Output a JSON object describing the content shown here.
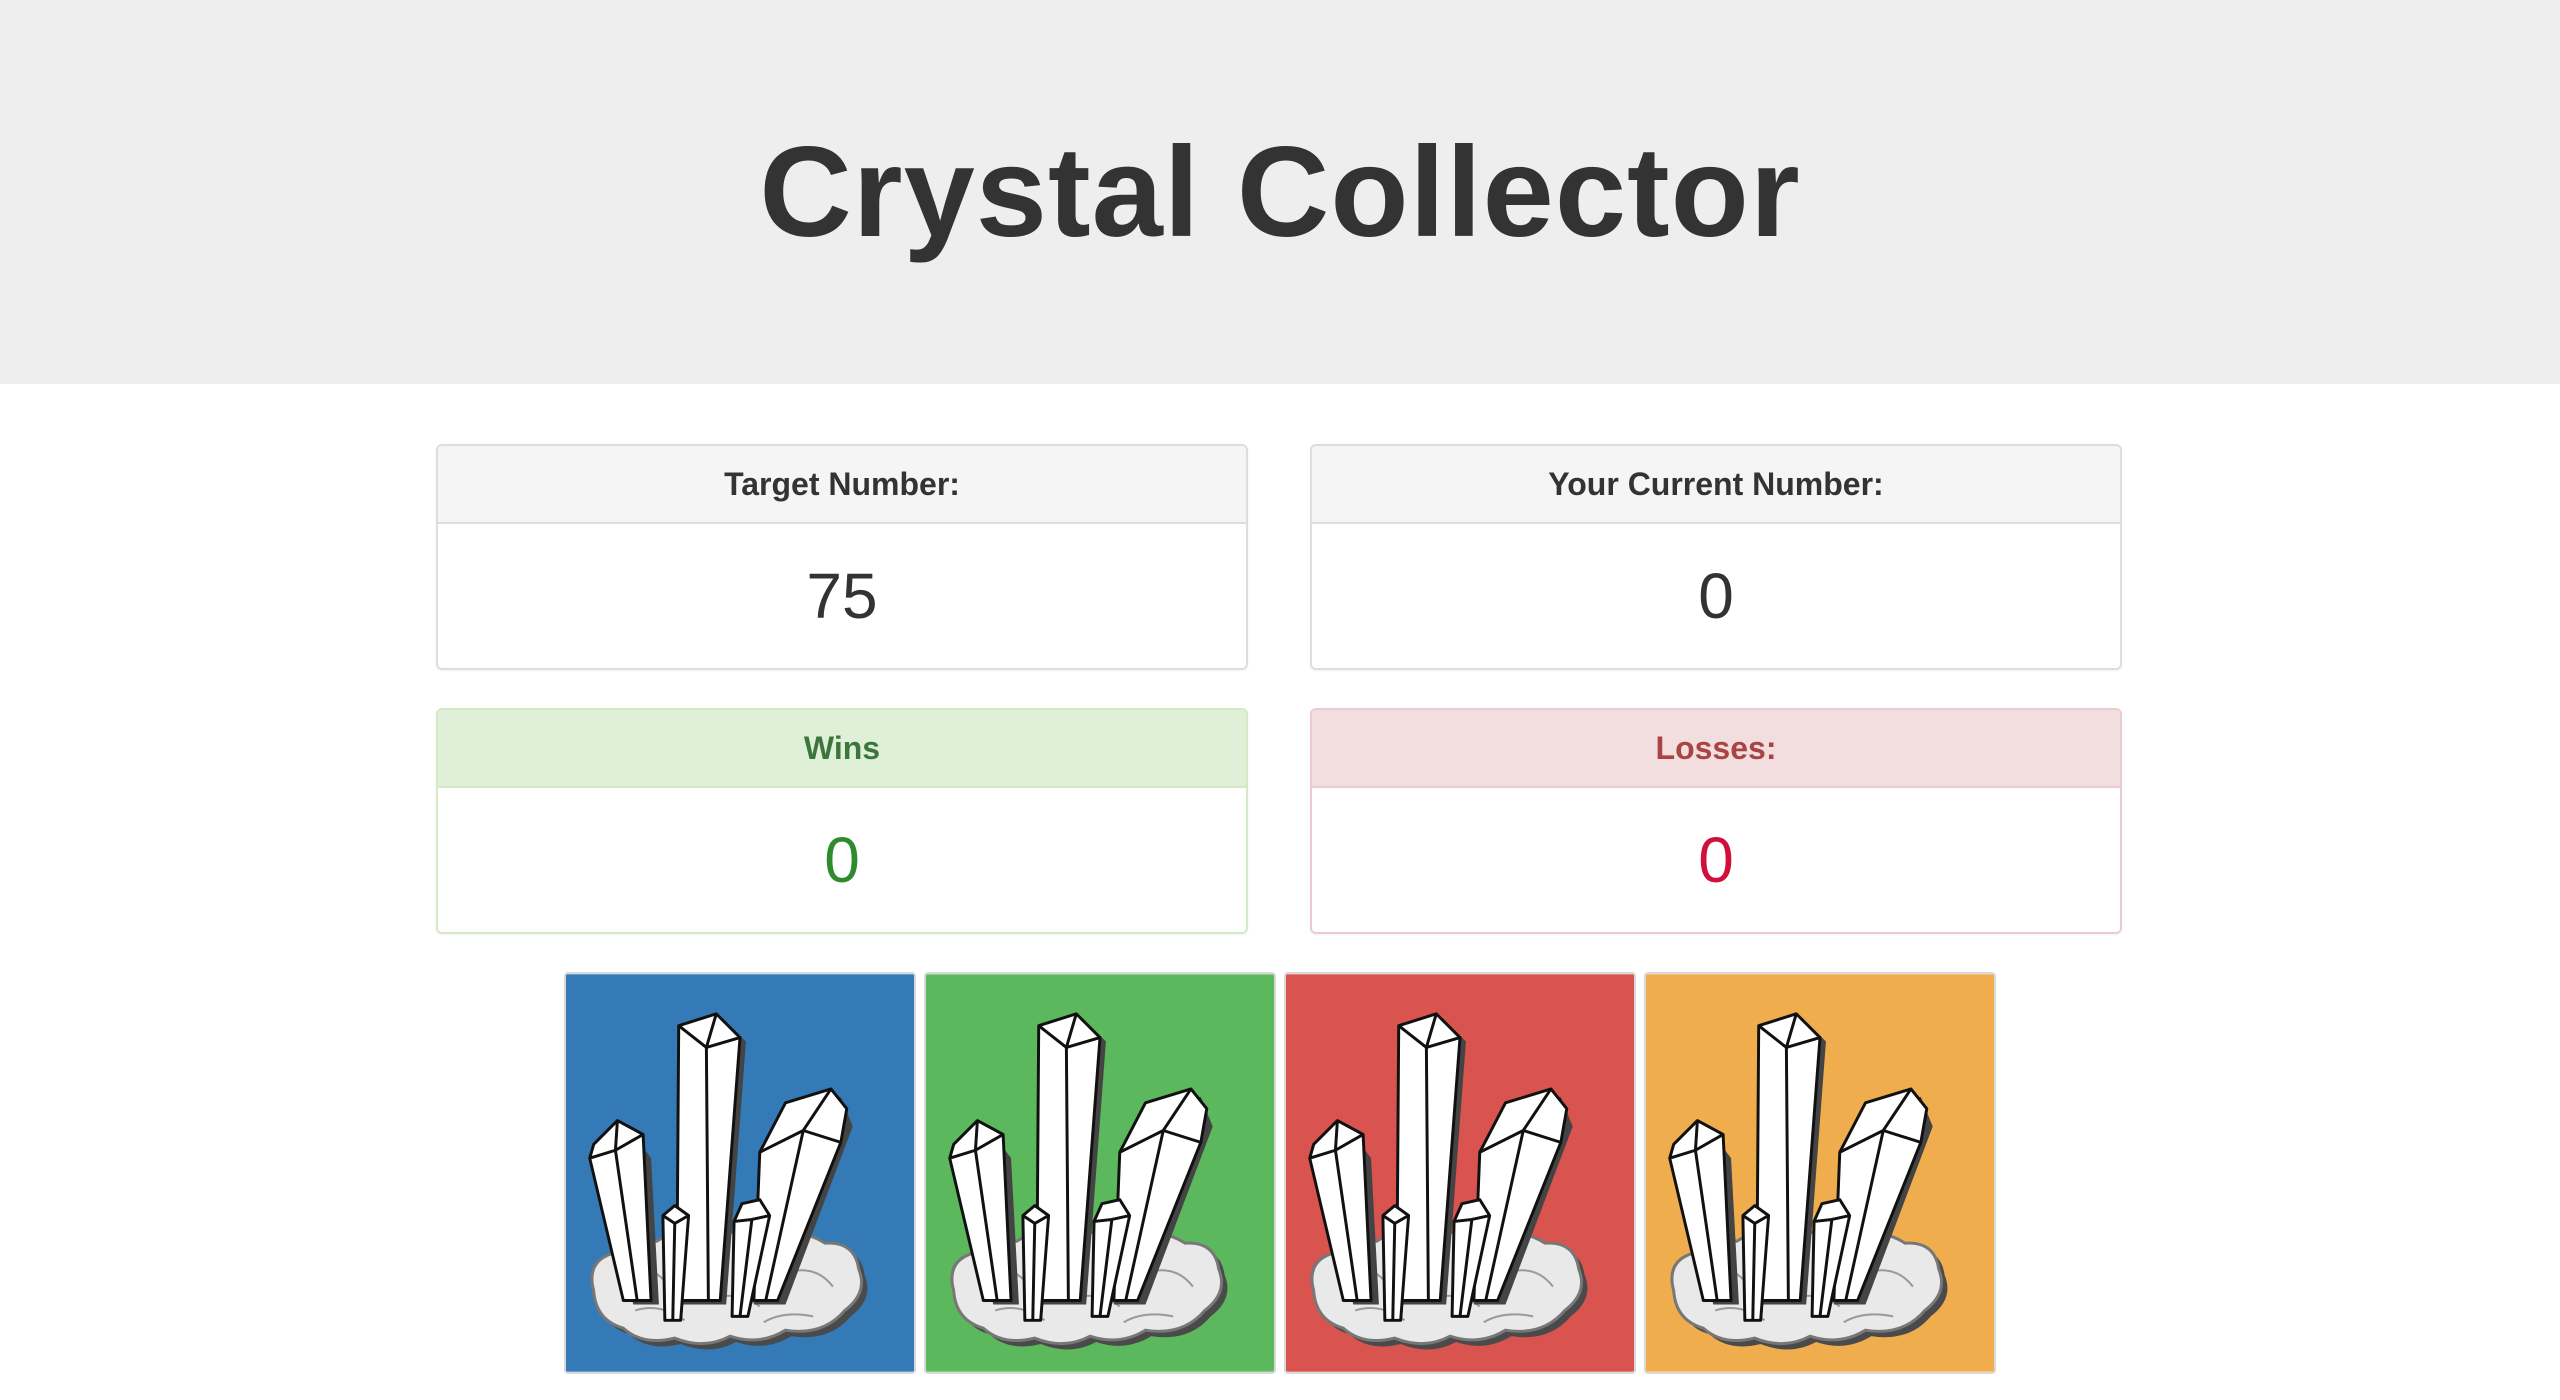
{
  "title": "Crystal Collector",
  "panels": {
    "target": {
      "label": "Target Number:",
      "value": "75"
    },
    "current": {
      "label": "Your Current Number:",
      "value": "0"
    },
    "wins": {
      "label": "Wins",
      "value": "0"
    },
    "losses": {
      "label": "Losses:",
      "value": "0"
    }
  },
  "crystals": [
    {
      "name": "blue-crystal",
      "color": "#337ab7",
      "icon": "crystal-cluster-icon"
    },
    {
      "name": "green-crystal",
      "color": "#5cb85c",
      "icon": "crystal-cluster-icon"
    },
    {
      "name": "red-crystal",
      "color": "#d9534f",
      "icon": "crystal-cluster-icon"
    },
    {
      "name": "orange-crystal",
      "color": "#f0ad4e",
      "icon": "crystal-cluster-icon"
    }
  ]
}
